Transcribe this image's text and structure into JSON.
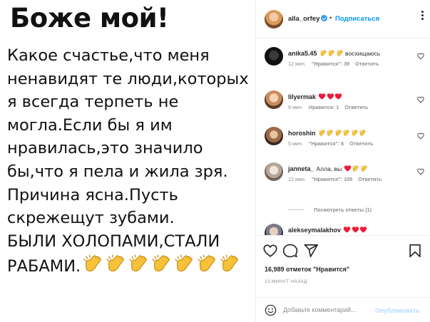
{
  "post_image": {
    "title": "Боже мой!",
    "lines": [
      "Какое счастье,что меня",
      "ненавидят те люди,которых",
      "я всегда терпеть не",
      "могла.Если бы я им",
      "нравилась,это значило",
      "бы,что я пела и жила зря.",
      "Причина ясна.Пусть",
      "скрежещут зубами.",
      "БЫЛИ ХОЛОПАМИ,СТАЛИ",
      "РАБАМИ."
    ],
    "clap_count": 7
  },
  "header": {
    "username": "alla_orfey",
    "separator": "•",
    "follow_label": "Подписаться"
  },
  "comments": [
    {
      "username": "anika5.45",
      "text": "восхищаюсь",
      "emojis": [
        "clap",
        "clap",
        "clap-hand"
      ],
      "time": "12 мин.",
      "likes": "\"Нравится\": 39",
      "reply": "Ответить"
    },
    {
      "username": "lilyermak",
      "text": "",
      "emojis": [
        "heart",
        "heart",
        "heart"
      ],
      "time": "9 мин.",
      "likes": "Нравится: 1",
      "reply": "Ответить"
    },
    {
      "username": "horoshin",
      "text": "",
      "emojis": [
        "clap",
        "clap",
        "clap",
        "clap",
        "clap",
        "clap"
      ],
      "time": "5 мин.",
      "likes": "\"Нравится\": 6",
      "reply": "Ответить"
    },
    {
      "username": "janneta_",
      "text": "Алла, вы",
      "emojis": [
        "heart",
        "clap",
        "clap"
      ],
      "time": "12 мин.",
      "likes": "\"Нравится\": 105",
      "reply": "Ответить"
    },
    {
      "username": "alekseymalakhov",
      "text": "",
      "emojis": [
        "heart",
        "heart",
        "heart"
      ],
      "time": "",
      "likes": "",
      "reply": ""
    }
  ],
  "view_replies": "Посмотреть ответы (1)",
  "footer": {
    "likes_text": "16,989 отметок \"Нравится\"",
    "time_ago": "13 МИНУТ НАЗАД",
    "comment_placeholder": "Добавьте комментарий...",
    "publish_label": "Опубликовать"
  },
  "colors": {
    "accent": "#0095f6",
    "verified": "#3897f0",
    "heart": "#ed1c3a",
    "clap": "#f7c23a",
    "muted": "#8e8e8e"
  },
  "icons": [
    "like-icon",
    "comment-icon",
    "share-icon",
    "save-icon",
    "emoji-smile-icon",
    "more-options-icon",
    "verified-badge-icon"
  ]
}
